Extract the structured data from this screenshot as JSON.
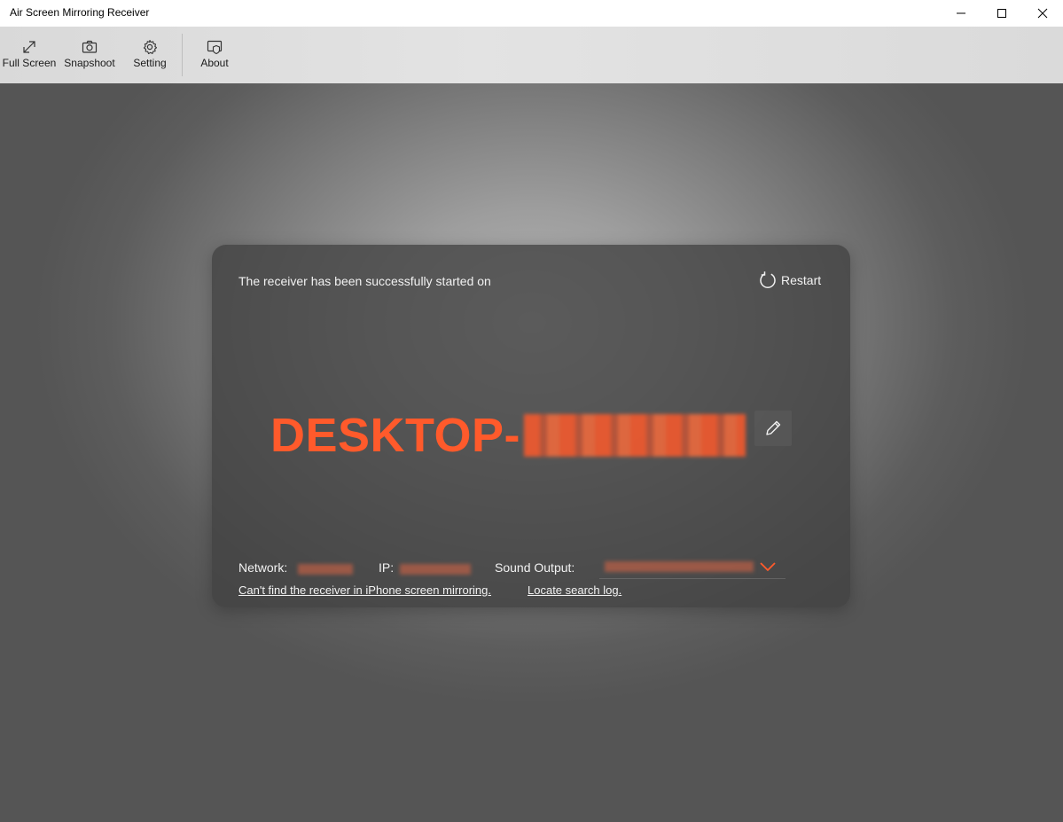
{
  "window": {
    "title": "Air Screen Mirroring Receiver",
    "controls": [
      "minimize",
      "maximize",
      "close"
    ]
  },
  "toolbar": {
    "items": [
      {
        "label": "Full Screen",
        "icon": "expand-icon"
      },
      {
        "label": "Snapshoot",
        "icon": "camera-icon"
      },
      {
        "label": "Setting",
        "icon": "gear-icon"
      },
      {
        "label": "About",
        "icon": "about-icon"
      }
    ]
  },
  "card": {
    "status_text": "The receiver has been successfully started on",
    "restart_label": "Restart",
    "device_name_prefix": "DESKTOP-",
    "device_name_suffix_redacted": true,
    "network_label": "Network:",
    "ip_label": "IP:",
    "sound_output_label": "Sound Output:",
    "help_link": "Can't find the receiver in iPhone screen mirroring.",
    "log_link": "Locate search log.",
    "accent_color": "#ff5a2b"
  }
}
